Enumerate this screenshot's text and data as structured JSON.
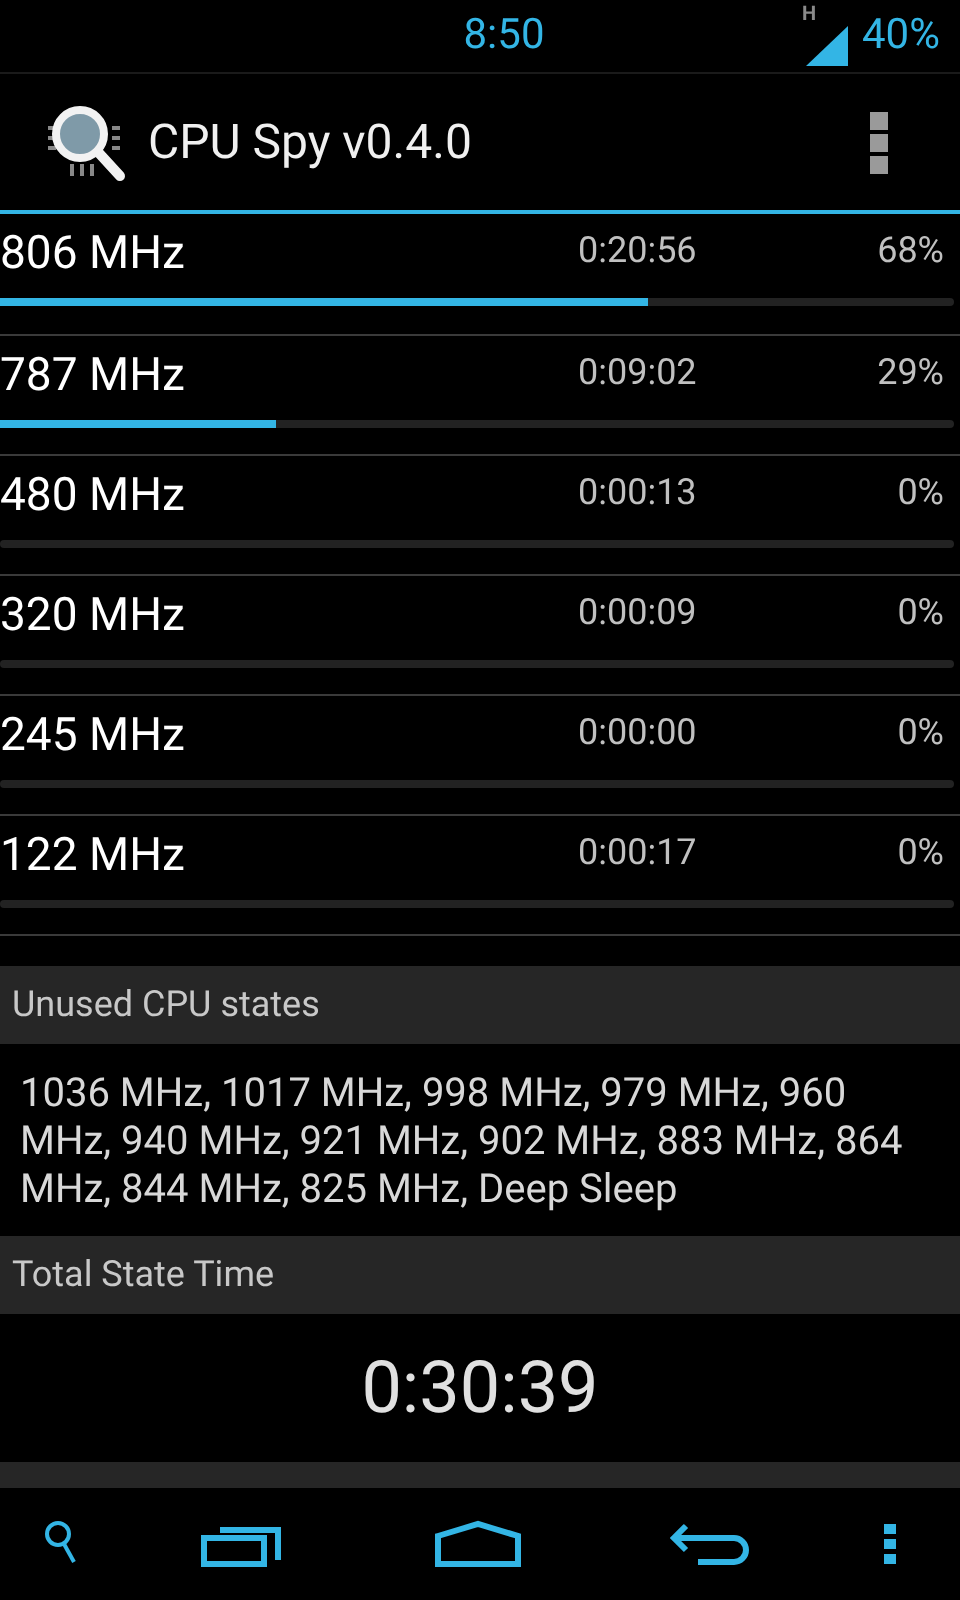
{
  "status_bar": {
    "time": "8:50",
    "network": "H",
    "battery": "40%"
  },
  "action_bar": {
    "title": "CPU Spy v0.4.0"
  },
  "states": [
    {
      "frequency": "806 MHz",
      "duration": "0:20:56",
      "percent": "68%",
      "level": 0.68
    },
    {
      "frequency": "787 MHz",
      "duration": "0:09:02",
      "percent": "29%",
      "level": 0.29
    },
    {
      "frequency": "480 MHz",
      "duration": "0:00:13",
      "percent": "0%",
      "level": 0
    },
    {
      "frequency": "320 MHz",
      "duration": "0:00:09",
      "percent": "0%",
      "level": 0
    },
    {
      "frequency": "245 MHz",
      "duration": "0:00:00",
      "percent": "0%",
      "level": 0
    },
    {
      "frequency": "122 MHz",
      "duration": "0:00:17",
      "percent": "0%",
      "level": 0
    }
  ],
  "unused_states": {
    "header": "Unused CPU states",
    "text": "1036 MHz, 1017 MHz, 998 MHz, 979 MHz, 960 MHz, 940 MHz, 921 MHz, 902 MHz, 883 MHz, 864 MHz, 844 MHz, 825 MHz, Deep Sleep"
  },
  "total_state_time": {
    "header": "Total State Time",
    "value": "0:30:39"
  }
}
